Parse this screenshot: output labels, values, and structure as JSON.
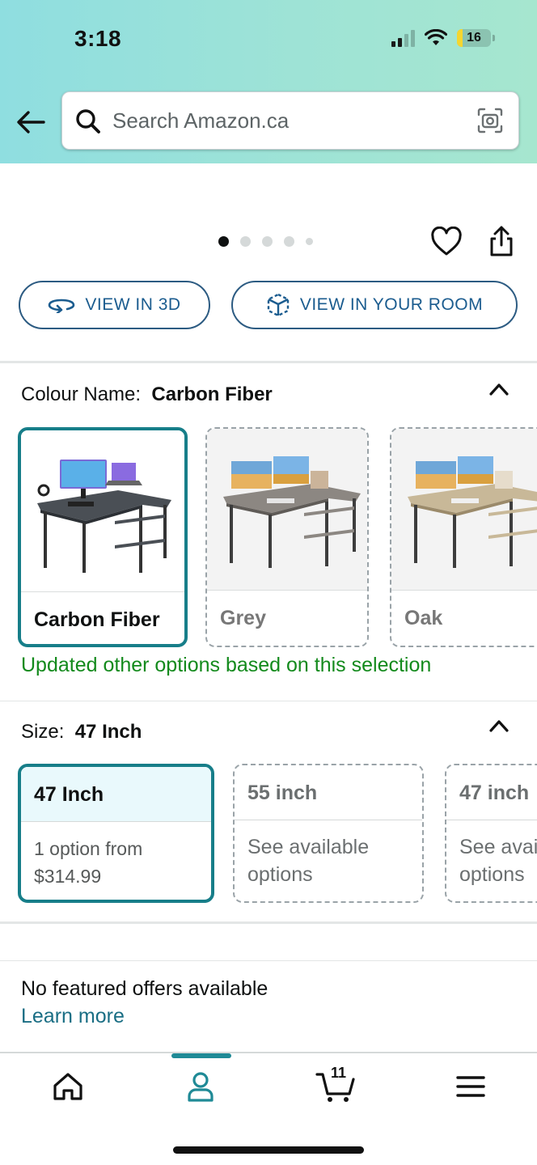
{
  "status_bar": {
    "time": "3:18",
    "battery": "16"
  },
  "search": {
    "placeholder": "Search Amazon.ca"
  },
  "media": {
    "view_3d_label": "VIEW IN 3D",
    "view_room_label": "VIEW IN YOUR ROOM",
    "page_count": 5,
    "current_page": 1
  },
  "colour": {
    "label": "Colour Name:",
    "selected": "Carbon Fiber",
    "options": [
      {
        "label": "Carbon Fiber",
        "selected": true
      },
      {
        "label": "Grey",
        "selected": false
      },
      {
        "label": "Oak",
        "selected": false
      }
    ],
    "update_note": "Updated other options based on this selection"
  },
  "size": {
    "label": "Size:",
    "selected": "47 Inch",
    "options": [
      {
        "name": "47 Inch",
        "line1": "1 option from",
        "line2": "$314.99",
        "selected": true
      },
      {
        "name": "55 inch",
        "line1": "See available",
        "line2": "options",
        "selected": false
      },
      {
        "name": "47 inch",
        "line1": "See avail",
        "line2": "options",
        "selected": false
      }
    ]
  },
  "offers": {
    "text": "No featured offers available",
    "link": "Learn more"
  },
  "nav": {
    "cart_count": "11",
    "active_tab": "account"
  },
  "colors": {
    "accent": "#177e89",
    "link": "#1a6e84",
    "success": "#138a1c",
    "button_text": "#1b5c8f"
  }
}
